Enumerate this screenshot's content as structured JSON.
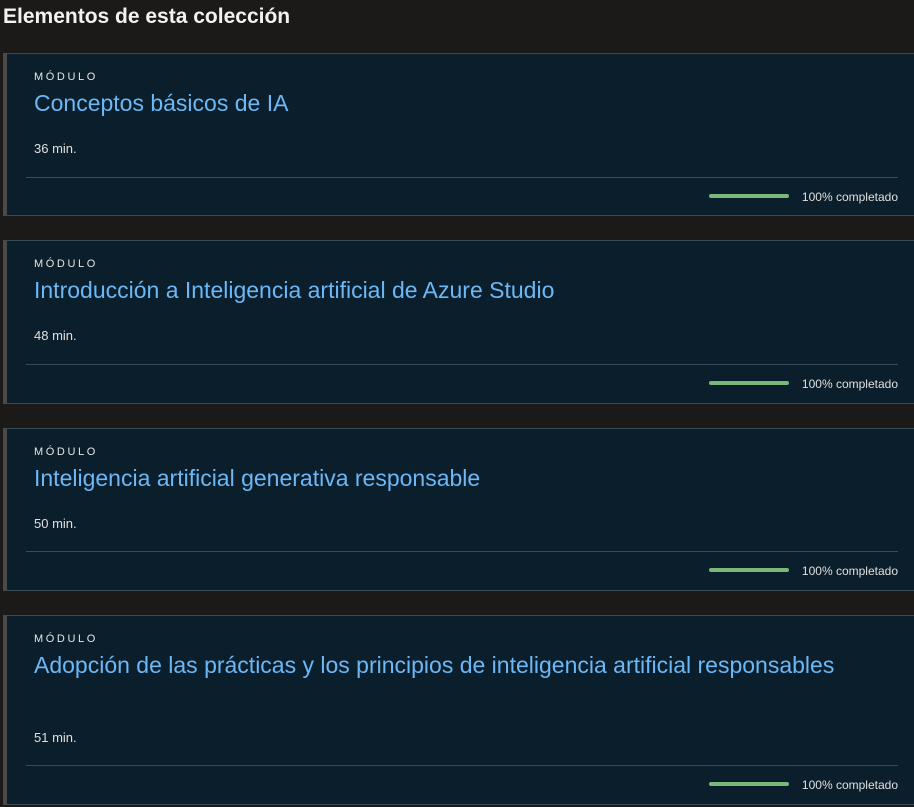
{
  "page": {
    "title": "Elementos de esta colección"
  },
  "colors": {
    "background": "#1b1a19",
    "card_background": "#0b1e2c",
    "link": "#6cb8f6",
    "progress": "#7ab87a"
  },
  "modules": [
    {
      "kicker": "MÓDULO",
      "title": "Conceptos básicos de IA",
      "duration": "36 min.",
      "progress_label": "100% completado",
      "progress_fraction": 1.0
    },
    {
      "kicker": "MÓDULO",
      "title": "Introducción a Inteligencia artificial de Azure Studio",
      "duration": "48 min.",
      "progress_label": "100% completado",
      "progress_fraction": 1.0
    },
    {
      "kicker": "MÓDULO",
      "title": "Inteligencia artificial generativa responsable",
      "duration": "50 min.",
      "progress_label": "100% completado",
      "progress_fraction": 1.0
    },
    {
      "kicker": "MÓDULO",
      "title": "Adopción de las prácticas y los principios de inteligencia artificial responsables",
      "duration": "51 min.",
      "progress_label": "100% completado",
      "progress_fraction": 1.0
    }
  ]
}
